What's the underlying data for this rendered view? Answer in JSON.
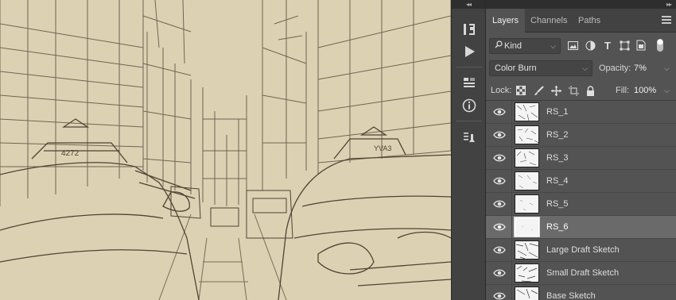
{
  "canvas": {
    "description_icon": "sketch-image",
    "taxi_sign_left": "4272",
    "taxi_sign_right": "YVA3"
  },
  "toolstrip": {
    "tools": [
      "history-icon",
      "actions-play-icon",
      "properties-icon",
      "info-icon",
      "character-styles-icon"
    ]
  },
  "panel": {
    "tabs": [
      {
        "label": "Layers",
        "active": true
      },
      {
        "label": "Channels",
        "active": false
      },
      {
        "label": "Paths",
        "active": false
      }
    ],
    "filter": {
      "kind_label": "Kind",
      "icons": [
        "image-filter-icon",
        "adjustment-filter-icon",
        "type-filter-icon",
        "shape-filter-icon",
        "smart-object-filter-icon",
        "filter-toggle-icon"
      ]
    },
    "blend_mode": "Color Burn",
    "opacity_label": "Opacity:",
    "opacity_value": "7%",
    "lock_label": "Lock:",
    "lock_icons": [
      "lock-transparent-icon",
      "lock-image-icon",
      "lock-position-icon",
      "lock-artboard-icon",
      "lock-all-icon"
    ],
    "fill_label": "Fill:",
    "fill_value": "100%",
    "layers": [
      {
        "name": "RS_1",
        "selected": false
      },
      {
        "name": "RS_2",
        "selected": false
      },
      {
        "name": "RS_3",
        "selected": false
      },
      {
        "name": "RS_4",
        "selected": false
      },
      {
        "name": "RS_5",
        "selected": false
      },
      {
        "name": "RS_6",
        "selected": true
      },
      {
        "name": "Large Draft Sketch",
        "selected": false
      },
      {
        "name": "Small Draft Sketch",
        "selected": false
      },
      {
        "name": "Base Sketch",
        "selected": false
      }
    ]
  },
  "colors": {
    "canvas_bg": "#ddd1b4",
    "sketch_stroke": "#5a5040",
    "panel_bg": "#535353",
    "selected_row": "#6a6a6a"
  }
}
